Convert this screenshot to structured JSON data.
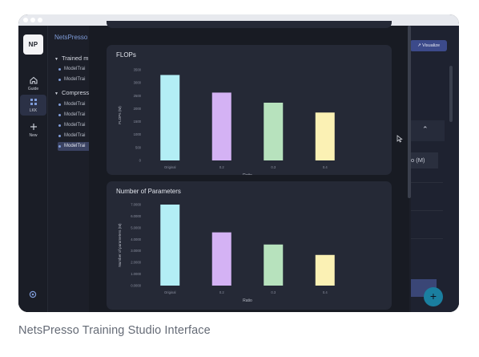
{
  "sidebar": {
    "logo": "NP",
    "rail": [
      {
        "label": "Guide",
        "icon": "home-icon"
      },
      {
        "label": "LKK",
        "icon": "grid-icon"
      },
      {
        "label": "New",
        "icon": "plus-icon"
      }
    ],
    "bottom_icon": "settings-icon"
  },
  "tree": {
    "title": "NetsPresso",
    "groups": [
      {
        "label": "Trained m",
        "leaves": [
          "ModelTrai",
          "ModelTrai"
        ]
      },
      {
        "label": "Compress",
        "leaves": [
          "ModelTrai",
          "ModelTrai",
          "ModelTrai",
          "ModelTrai",
          "ModelTrai"
        ]
      }
    ]
  },
  "right": {
    "visualize_label": "Visualize",
    "params_header": "o (M)",
    "expand_icon": "chevron-up-icon",
    "fab_label": "+"
  },
  "colors": {
    "bar_original": "#b3eef5",
    "bar_0_2": "#d4b2f4",
    "bar_0_3": "#b7e2bd",
    "bar_0_4": "#fbf1b4",
    "panel_bg": "#252936",
    "accent": "#3c4a8a"
  },
  "chart_data": [
    {
      "type": "bar",
      "title": "FLOPs",
      "xlabel": "Ratio",
      "ylabel": "FLOPs (M)",
      "categories": [
        "Original",
        "0.2",
        "0.3",
        "0.4"
      ],
      "values": [
        3300,
        2620,
        2230,
        1850
      ],
      "yticks": [
        "0",
        "500",
        "1000",
        "1500",
        "2000",
        "2500",
        "3000",
        "3500"
      ],
      "ylim": [
        0,
        3500
      ],
      "grid": false
    },
    {
      "type": "bar",
      "title": "Number of Parameters",
      "xlabel": "Ratio",
      "ylabel": "Number of parameters (M)",
      "categories": [
        "Original",
        "0.2",
        "0.3",
        "0.4"
      ],
      "values": [
        7.0,
        4.6,
        3.55,
        2.65
      ],
      "yticks": [
        "0.0000",
        "1.0000",
        "2.0000",
        "3.0000",
        "4.0000",
        "5.0000",
        "6.0000",
        "7.0000"
      ],
      "ylim": [
        0,
        7
      ],
      "grid": false
    }
  ],
  "caption": "NetsPresso Training Studio Interface"
}
